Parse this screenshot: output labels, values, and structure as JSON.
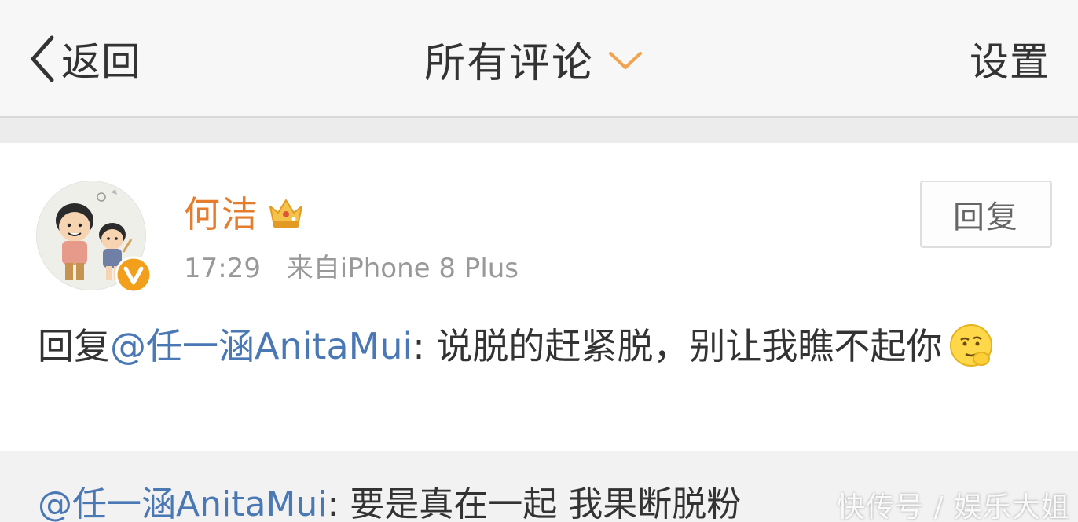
{
  "navbar": {
    "back_label": "返回",
    "title": "所有评论",
    "settings_label": "设置"
  },
  "comment": {
    "username": "何洁",
    "time": "17:29",
    "source": "来自iPhone 8 Plus",
    "reply_button_label": "回复",
    "text_prefix": "回复",
    "mention": "@任一涵AnitaMui",
    "text_body": ": 说脱的赶紧脱，别让我瞧不起你",
    "emoji": "smirk-hand-on-chin-emoji"
  },
  "quoted_reply": {
    "mention": "@任一涵AnitaMui",
    "text": ": 要是真在一起 我果断脱粉"
  },
  "watermark": "快传号 / 娱乐大姐",
  "colors": {
    "username": "#e57d2e",
    "mention": "#4a78b4",
    "chevron": "#f0a350",
    "vip_badge": "#f29f1b"
  }
}
